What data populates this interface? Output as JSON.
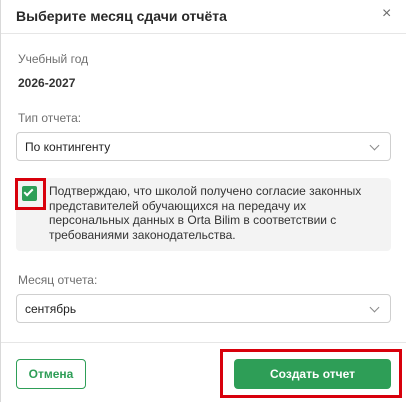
{
  "dialog": {
    "title": "Выберите месяц сдачи отчёта",
    "close_glyph": "×"
  },
  "academic_year": {
    "label": "Учебный год",
    "value": "2026-2027"
  },
  "report_type": {
    "label": "Тип отчета:",
    "selected": "По контингенту"
  },
  "consent": {
    "checked": true,
    "text": "Подтверждаю, что школой получено согласие законных представителей обучающихся на передачу их персональных данных в Orta Bilim в соответствии с требованиями законодательства."
  },
  "report_month": {
    "label": "Месяц отчета:",
    "selected": "сентябрь"
  },
  "footer": {
    "cancel_label": "Отмена",
    "submit_label": "Создать отчет"
  },
  "colors": {
    "accent": "#2e9e57",
    "highlight": "#d8000c"
  }
}
